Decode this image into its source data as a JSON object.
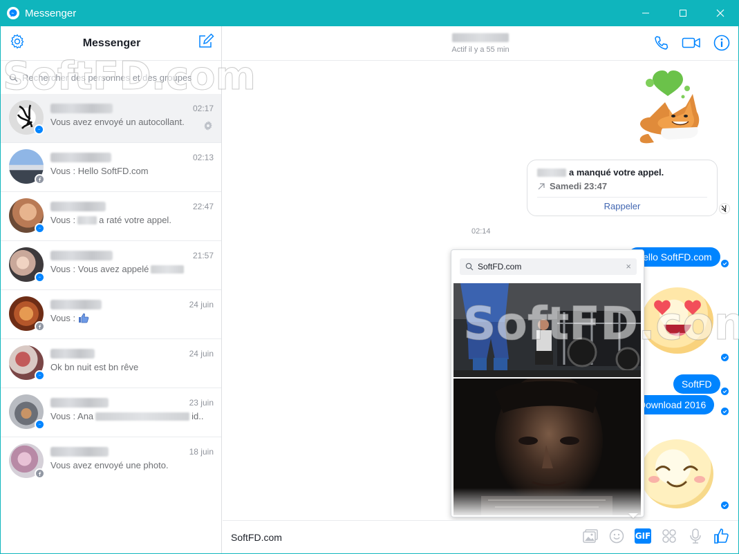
{
  "window": {
    "title": "Messenger",
    "minimize_icon": "minimize-icon",
    "maximize_icon": "maximize-icon",
    "close_icon": "close-icon"
  },
  "sidebar": {
    "title": "Messenger",
    "search_placeholder": "Rechercher des personnes et des groupes",
    "conversations": [
      {
        "time": "02:17",
        "snippet": "Vous avez envoyé un autocollant.",
        "badge": "messenger",
        "active": true
      },
      {
        "time": "02:13",
        "snippet": "Vous : Hello SoftFD.com",
        "badge": "facebook"
      },
      {
        "time": "22:47",
        "snippet_pre": "Vous :",
        "snippet_post": "a raté votre appel.",
        "badge": "messenger"
      },
      {
        "time": "21:57",
        "snippet_pre": "Vous : Vous avez appelé",
        "snippet_post": "",
        "badge": "messenger"
      },
      {
        "time": "24 juin",
        "snippet": "Vous :",
        "badge": "facebook",
        "like": true
      },
      {
        "time": "24 juin",
        "snippet": "Ok bn nuit est bn rêve",
        "badge": "messenger"
      },
      {
        "time": "23 juin",
        "snippet_pre": "Vous : Ana",
        "snippet_post": "id..",
        "badge": "messenger"
      },
      {
        "time": "18 juin",
        "snippet": "Vous avez envoyé une photo.",
        "badge": "facebook"
      }
    ]
  },
  "chat": {
    "status": "Actif il y a 55 min",
    "missed_call": {
      "text": "a manqué votre appel.",
      "when": "Samedi 23:47",
      "action": "Rappeler"
    },
    "timestamp": "02:14",
    "messages": [
      "Hello SoftFD.com",
      "SoftFD",
      "Download 2016"
    ],
    "composer_value": "SoftFD.com"
  },
  "gif_picker": {
    "search_value": "SoftFD.com",
    "clear_label": "×"
  },
  "toolbar": {
    "gif_label": "GIF"
  },
  "watermark": "SoftFD.com",
  "colors": {
    "titlebar": "#0fb5bd",
    "accent": "#0084ff",
    "link": "#4267b2"
  }
}
